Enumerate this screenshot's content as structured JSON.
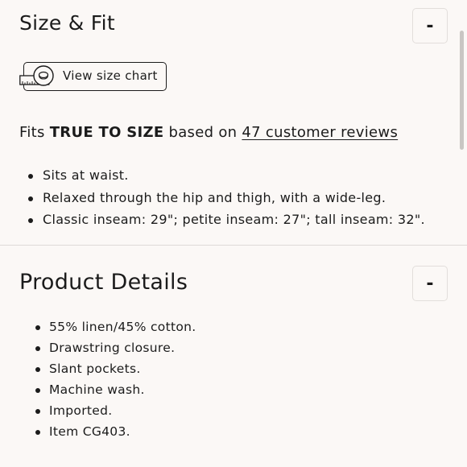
{
  "size_fit": {
    "title": "Size & Fit",
    "toggle_label": "-",
    "size_chart_button_label": "View size chart",
    "fit_prefix": "Fits ",
    "fit_emphasis": "TRUE TO SIZE",
    "fit_middle": " based on ",
    "fit_link": "47 customer reviews",
    "bullets": [
      "Sits at waist.",
      "Relaxed through the hip and thigh, with a wide-leg.",
      "Classic inseam: 29\"; petite inseam: 27\"; tall inseam: 32\"."
    ]
  },
  "product_details": {
    "title": "Product Details",
    "toggle_label": "-",
    "bullets": [
      "55% linen/45% cotton.",
      "Drawstring closure.",
      "Slant pockets.",
      "Machine wash.",
      "Imported.",
      "Item CG403."
    ]
  },
  "icons": {
    "size_chart": "measuring-tape-icon",
    "collapse": "minus-icon"
  },
  "colors": {
    "background": "#fbf8f6",
    "text": "#1b1b1b",
    "border": "#e2dedb"
  }
}
